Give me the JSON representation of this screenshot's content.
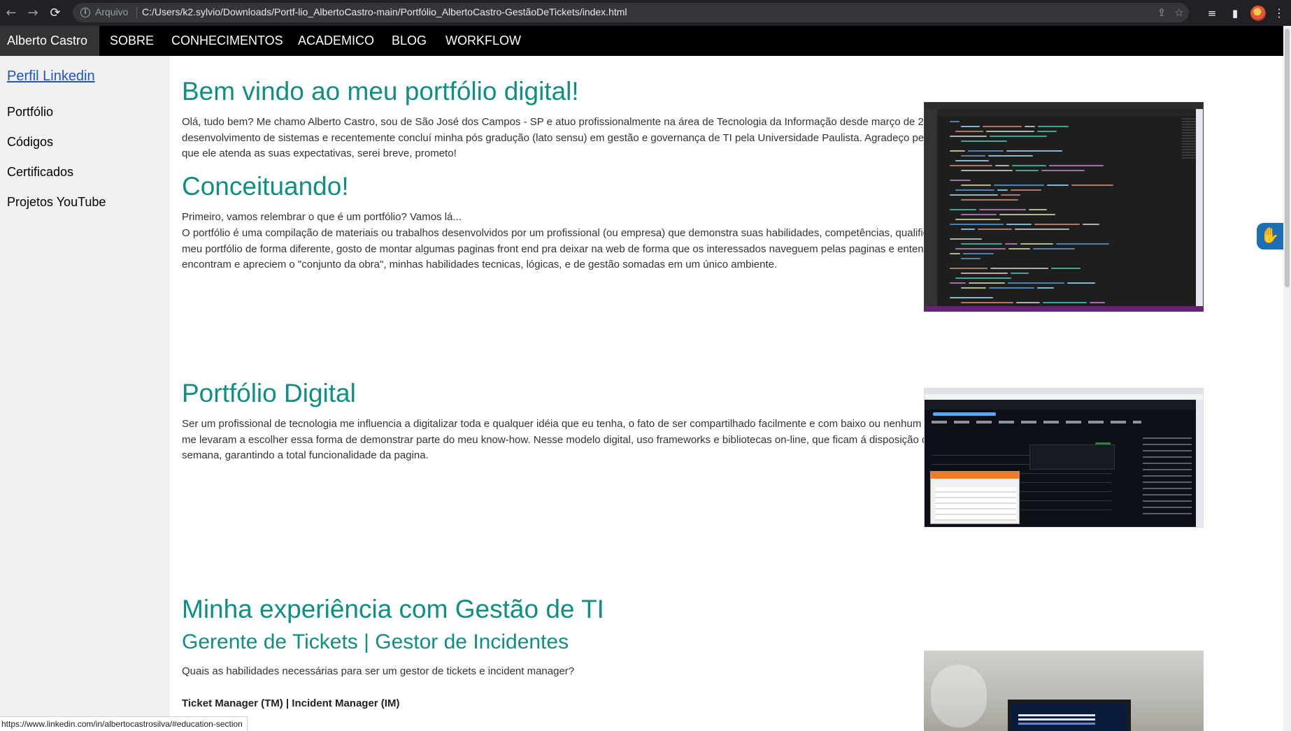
{
  "browser": {
    "back_icon": "←",
    "forward_icon": "→",
    "reload_icon": "⟳",
    "scheme_label": "Arquivo",
    "url": "C:/Users/k2.sylvio/Downloads/Portf-lio_AlbertoCastro-main/Portfólio_AlbertoCastro-GestãoDeTickets/index.html",
    "status_url": "https://www.linkedin.com/in/albertocastrosilva/#education-section"
  },
  "topnav": {
    "brand": "Alberto Castro",
    "items": [
      "SOBRE",
      "CONHECIMENTOS",
      "ACADEMICO",
      "BLOG",
      "WORKFLOW"
    ]
  },
  "sidebar": {
    "active": "Perfil Linkedin",
    "items": [
      "Portfólio",
      "Códigos",
      "Certificados",
      "Projetos YouTube"
    ]
  },
  "main": {
    "welcome_title": "Bem vindo ao meu portfólio digital!",
    "welcome_text": "Olá, tudo bem? Me chamo Alberto Castro, sou de São José dos Campos - SP e atuo profissionalmente na área de Tecnologia da Informação desde março de 2020. Sou formado em análise e desenvolvimento de sistemas e recentemente concluí minha pós gradução (lato sensu) em gestão e governança de TI pela Universidade Paulista. Agradeço pela visita ao meu portfolio, espero que ele atenda as suas expectativas, serei breve, prometo!",
    "concept_title": "Conceituando!",
    "concept_intro": "Primeiro, vamos relembrar o que é um portfólio? Vamos lá...",
    "concept_text": "O portfólio é uma compilação de materiais ou trabalhos desenvolvidos por um profissional (ou empresa) que demonstra suas habilidades, competências, qualificações e experiências. Uso o meu portfólio de forma diferente, gosto de montar algumas paginas front end pra deixar na web de forma que os interessados naveguem pelas paginas e entendam as funcionalidades que encontram e apreciem o \"conjunto da obra\", minhas habilidades tecnicas, lógicas, e de gestão somadas em um único ambiente.",
    "digital_title": "Portfólio Digital",
    "digital_text": "Ser um profissional de tecnologia me influencia a digitalizar toda e qualquer idéia que eu tenha, o fato de ser compartilhado facilmente e com baixo ou nenhum custo foram os requisitos que me levaram a escolher essa forma de demonstrar parte do meu know-how. Nesse modelo digital, uso frameworks e bibliotecas on-line, que ficam á disposição da web 24hs por 7 dias na semana, garantindo a total funcionalidade da pagina.",
    "experience_title": "Minha experiência com Gestão de TI",
    "tickets_title": "Gerente de Tickets | Gestor de Incidentes",
    "tickets_question": "Quais as habilidades necessárias para ser um gestor de tickets e incident manager?",
    "tickets_roles": "Ticket Manager (TM) | Incident Manager (IM)"
  },
  "widgets": {
    "a11y_icon": "sign-language-icon",
    "a11y_glyph": "✋"
  }
}
